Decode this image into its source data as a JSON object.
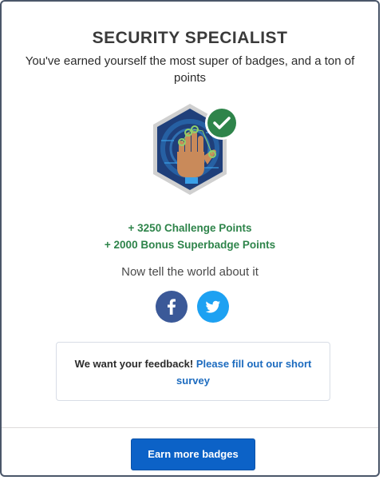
{
  "dialog": {
    "title": "SECURITY SPECIALIST",
    "subtitle": "You've earned yourself the most super of badges, and a ton of points"
  },
  "badge": {
    "icon": "security-hand-badge-icon",
    "check_icon": "check-icon",
    "colors": {
      "hex_border": "#c9c9c9",
      "hex_fill": "#1f3f7a",
      "check": "#2e844a"
    }
  },
  "points": {
    "challenge": "+ 3250 Challenge Points",
    "bonus": "+ 2000 Bonus Superbadge Points"
  },
  "share": {
    "prompt": "Now tell the world about it",
    "facebook_icon": "facebook-icon",
    "twitter_icon": "twitter-icon"
  },
  "feedback": {
    "text": "We want your feedback!",
    "link": "Please fill out our short survey"
  },
  "footer": {
    "button_label": "Earn more badges",
    "button_color": "#0c62c7"
  }
}
